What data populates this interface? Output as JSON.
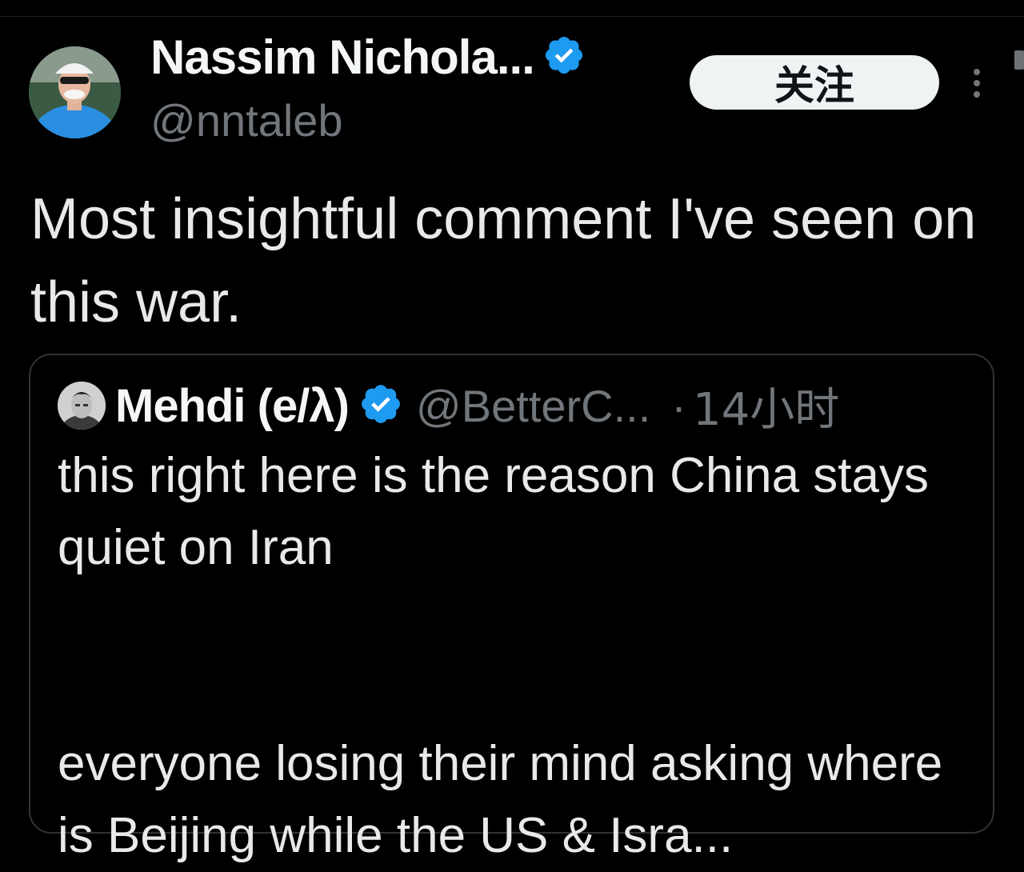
{
  "tweet": {
    "author": {
      "display_name": "Nassim Nichola...",
      "handle": "@nntaleb",
      "verified": true,
      "avatar_icon": "avatar-photo-cyclist"
    },
    "follow_label": "关注",
    "more_icon": "more-vertical-icon",
    "text": "Most insightful comment I've seen on this war."
  },
  "quoted_tweet": {
    "author": {
      "display_name": "Mehdi (e/λ)",
      "handle": "@BetterC...",
      "verified": true,
      "avatar_icon": "avatar-photo"
    },
    "separator": "·",
    "time": "14小时",
    "text": "this right here is the reason China stays quiet on Iran\n\n\neveryone losing their mind asking where is Beijing while the US & Isra..."
  },
  "colors": {
    "background": "#000000",
    "text_primary": "#e7e9ea",
    "text_secondary": "#71767b",
    "verified_badge": "#1d9bf0",
    "follow_button_bg": "#eff3f4",
    "card_border": "#2f3336"
  }
}
